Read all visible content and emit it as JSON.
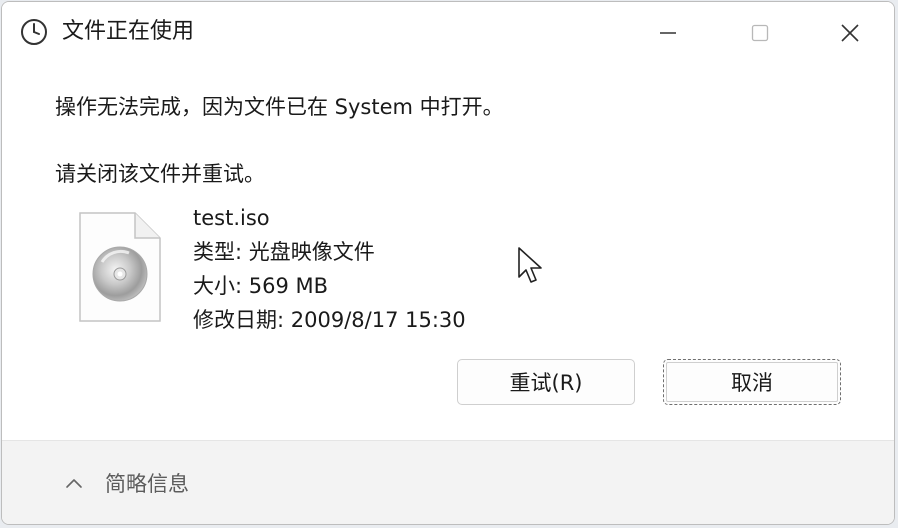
{
  "window": {
    "title": "文件正在使用"
  },
  "message": {
    "line1": "操作无法完成，因为文件已在 System 中打开。",
    "line2": "请关闭该文件并重试。"
  },
  "file": {
    "name": "test.iso",
    "type": "类型: 光盘映像文件",
    "size": "大小: 569 MB",
    "modified": "修改日期: 2009/8/17 15:30"
  },
  "buttons": {
    "retry": "重试(R)",
    "cancel": "取消"
  },
  "footer": {
    "details": "简略信息"
  },
  "icons": {
    "title": "clock-icon",
    "file": "disc-image-file-icon",
    "minimize": "minimize-icon",
    "maximize": "maximize-icon",
    "close": "close-icon",
    "collapse": "chevron-up-icon"
  }
}
